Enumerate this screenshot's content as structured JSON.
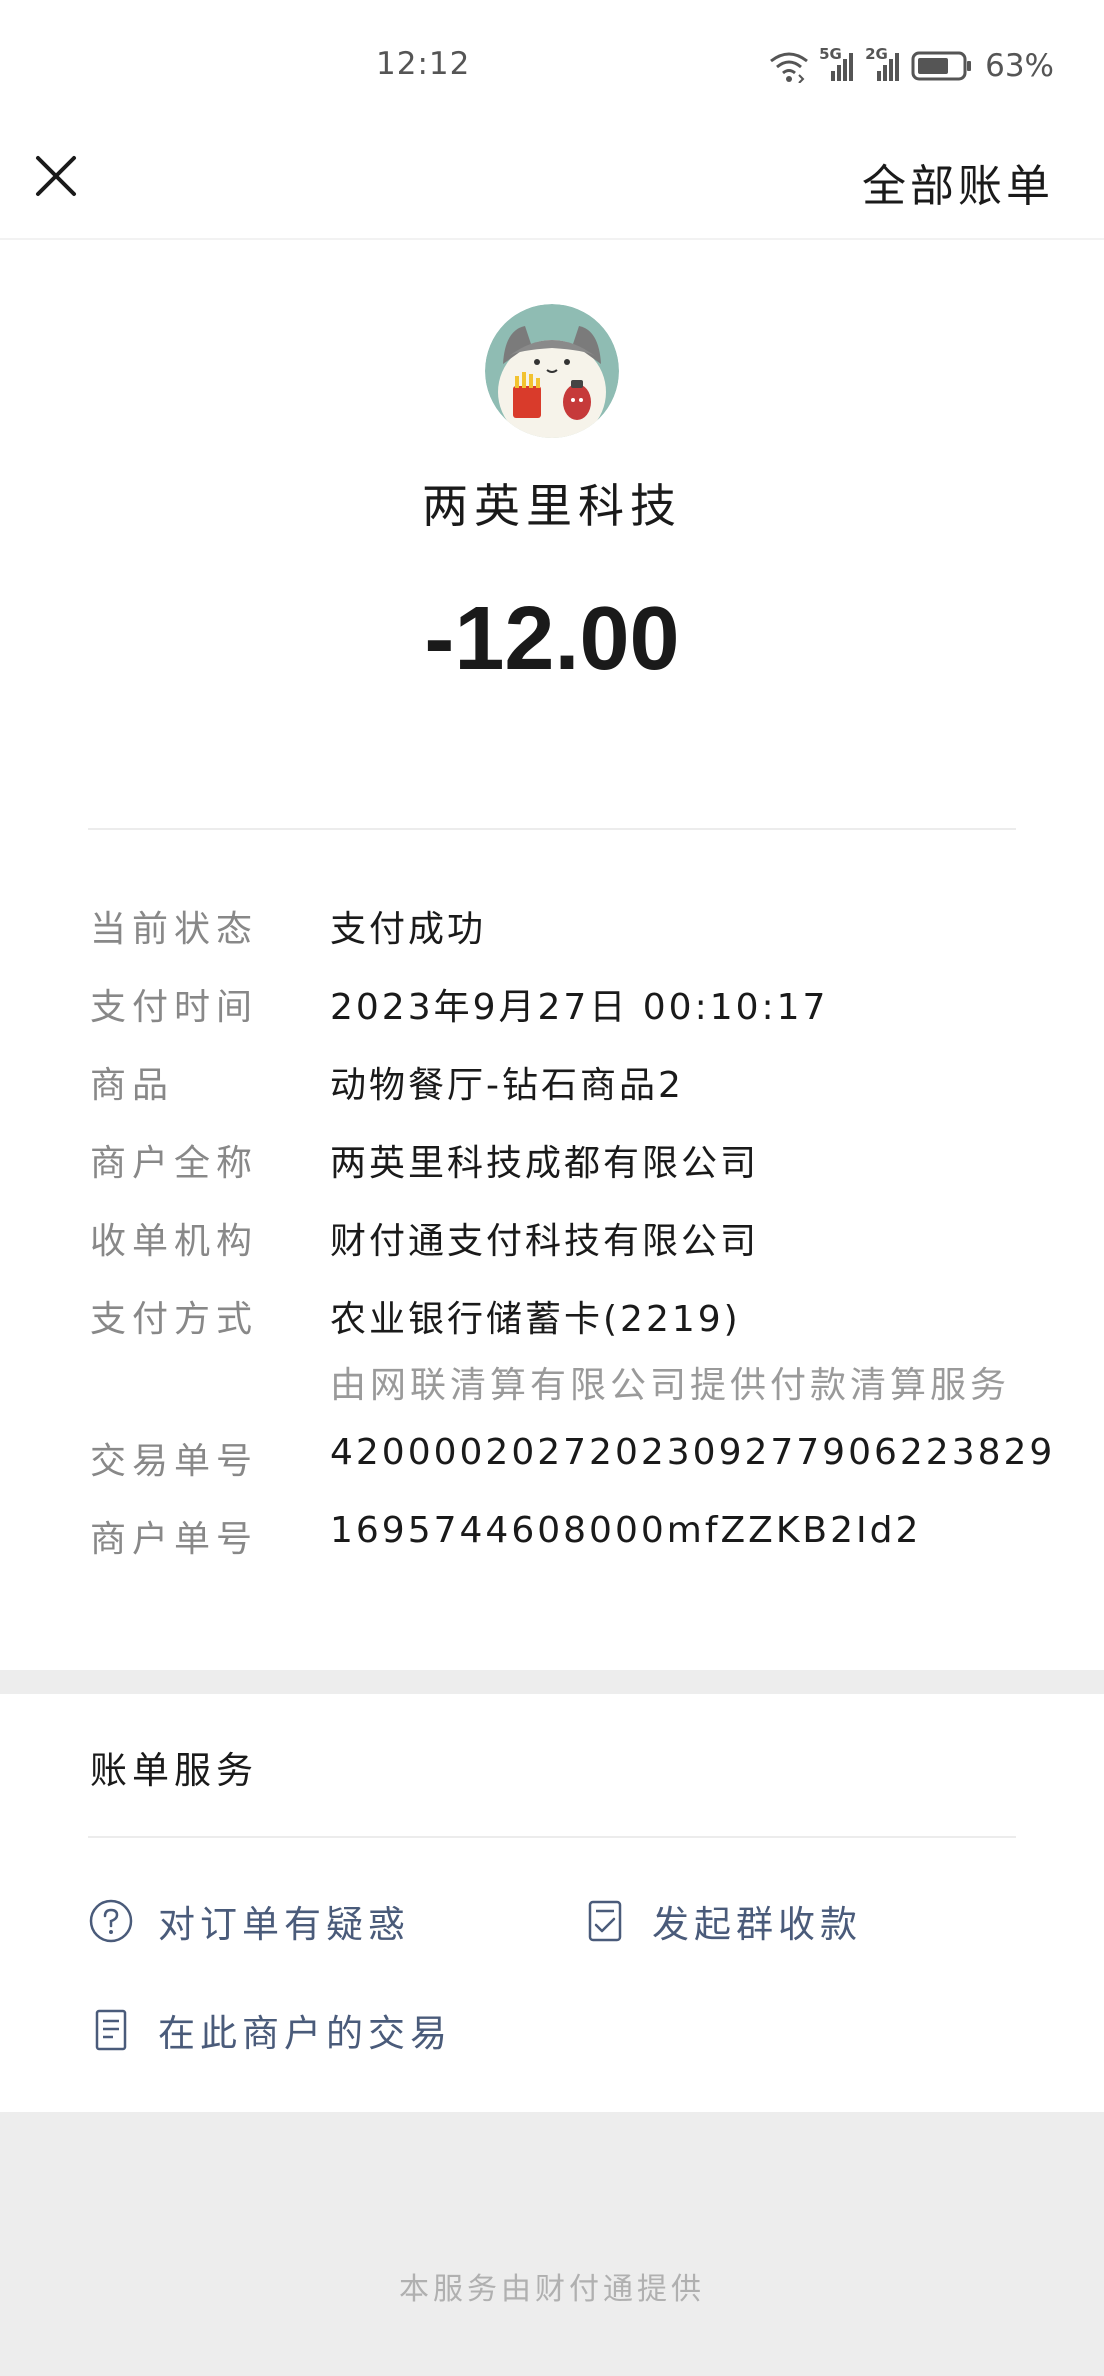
{
  "status_bar": {
    "time": "12:12",
    "network_1": "5G",
    "network_2": "2G",
    "battery_percent": "63%"
  },
  "nav": {
    "all_bills": "全部账单"
  },
  "merchant": {
    "name": "两英里科技",
    "amount": "-12.00"
  },
  "details": [
    {
      "label": "当前状态",
      "value": "支付成功"
    },
    {
      "label": "支付时间",
      "value": "2023年9月27日 00:10:17"
    },
    {
      "label": "商品",
      "value": "动物餐厅-钻石商品2"
    },
    {
      "label": "商户全称",
      "value": "两英里科技成都有限公司"
    },
    {
      "label": "收单机构",
      "value": "财付通支付科技有限公司"
    },
    {
      "label": "支付方式",
      "value": "农业银行储蓄卡(2219)",
      "note": "由网联清算有限公司提供付款清算服务"
    },
    {
      "label": "交易单号",
      "value": "4200002027202309277906223829"
    },
    {
      "label": "商户单号",
      "value": "1695744608000mfZZKB2Id2"
    }
  ],
  "services": {
    "title": "账单服务",
    "items": [
      {
        "label": "对订单有疑惑",
        "icon": "question-circle-icon"
      },
      {
        "label": "发起群收款",
        "icon": "checklist-icon"
      },
      {
        "label": "在此商户的交易",
        "icon": "document-icon"
      }
    ]
  },
  "footer": {
    "text": "本服务由财付通提供"
  },
  "colors": {
    "service_link": "#4a5b7a",
    "label_gray": "#888888",
    "gap_gray": "#ededed",
    "avatar_bg": "#8fbcb3"
  }
}
